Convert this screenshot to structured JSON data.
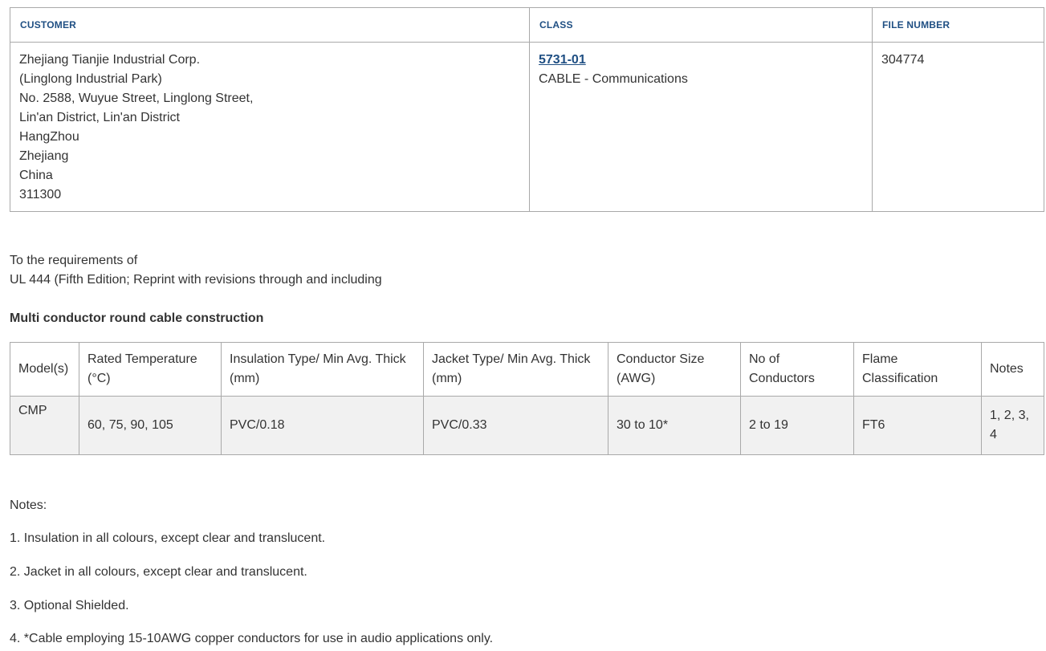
{
  "info": {
    "headers": {
      "customer": "CUSTOMER",
      "class": "CLASS",
      "file_number": "FILE NUMBER"
    },
    "customer_lines": [
      "Zhejiang Tianjie Industrial Corp.",
      "(Linglong Industrial Park)",
      "No. 2588, Wuyue Street, Linglong Street,",
      "Lin'an District, Lin'an District",
      "HangZhou",
      "Zhejiang",
      "China",
      "311300"
    ],
    "class_code": "5731-01",
    "class_desc": "CABLE - Communications",
    "file_number": "304774"
  },
  "requirements": {
    "line1": "To the requirements of",
    "line2": "UL 444 (Fifth Edition; Reprint with revisions through and including"
  },
  "construction_heading": "Multi conductor round cable construction",
  "cable_table": {
    "headers": [
      "Model(s)",
      "Rated Temperature (°C)",
      "Insulation Type/ Min Avg. Thick (mm)",
      "Jacket Type/ Min Avg. Thick (mm)",
      "Conductor Size (AWG)",
      "No of Conductors",
      "Flame Classification",
      "Notes"
    ],
    "rows": [
      [
        "CMP",
        "60, 75, 90, 105",
        "PVC/0.18",
        "PVC/0.33",
        "30 to 10*",
        "2 to 19",
        "FT6",
        "1, 2, 3, 4"
      ]
    ]
  },
  "notes": {
    "label": "Notes:",
    "items": [
      "1. Insulation in all colours, except clear and translucent.",
      "2. Jacket in all colours, except clear and translucent.",
      "3. Optional Shielded.",
      "4. *Cable employing 15-10AWG copper conductors for use in audio applications only."
    ]
  }
}
